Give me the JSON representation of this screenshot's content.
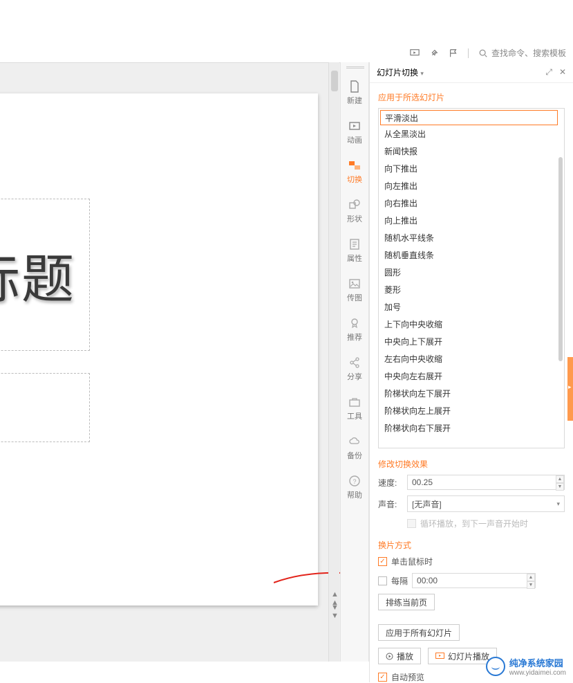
{
  "top": {
    "search_placeholder": "查找命令、搜索模板"
  },
  "sidebar": {
    "items": [
      {
        "name": "new",
        "label": "新建"
      },
      {
        "name": "anim",
        "label": "动画"
      },
      {
        "name": "trans",
        "label": "切换"
      },
      {
        "name": "shape",
        "label": "形状"
      },
      {
        "name": "prop",
        "label": "属性"
      },
      {
        "name": "img",
        "label": "传图"
      },
      {
        "name": "rec",
        "label": "推荐"
      },
      {
        "name": "share",
        "label": "分享"
      },
      {
        "name": "tool",
        "label": "工具"
      },
      {
        "name": "backup",
        "label": "备份"
      },
      {
        "name": "help",
        "label": "帮助"
      }
    ]
  },
  "slide": {
    "title": "标题"
  },
  "panel": {
    "title": "幻灯片切换",
    "section_transitions": "应用于所选幻灯片",
    "trans_selected": "平滑淡出",
    "trans_items": [
      "从全黑淡出",
      "新闻快报",
      "向下推出",
      "向左推出",
      "向右推出",
      "向上推出",
      "随机水平线条",
      "随机垂直线条",
      "圆形",
      "菱形",
      "加号",
      "上下向中央收缩",
      "中央向上下展开",
      "左右向中央收缩",
      "中央向左右展开",
      "阶梯状向左下展开",
      "阶梯状向左上展开",
      "阶梯状向右下展开"
    ],
    "section_modify": "修改切换效果",
    "speed_label": "速度:",
    "speed_value": "00.25",
    "sound_label": "声音:",
    "sound_value": "[无声音]",
    "loop_label": "循环播放，到下一声音开始时",
    "section_advance": "换片方式",
    "advance_click": "单击鼠标时",
    "advance_every_label": "每隔",
    "advance_every_value": "00:00",
    "rehearse_btn": "排练当前页",
    "apply_all_btn": "应用于所有幻灯片",
    "play_btn": "播放",
    "slideshow_btn": "幻灯片播放",
    "auto_preview": "自动预览"
  },
  "watermark": {
    "brand": "纯净系统家园",
    "url": "www.yidaimei.com"
  }
}
